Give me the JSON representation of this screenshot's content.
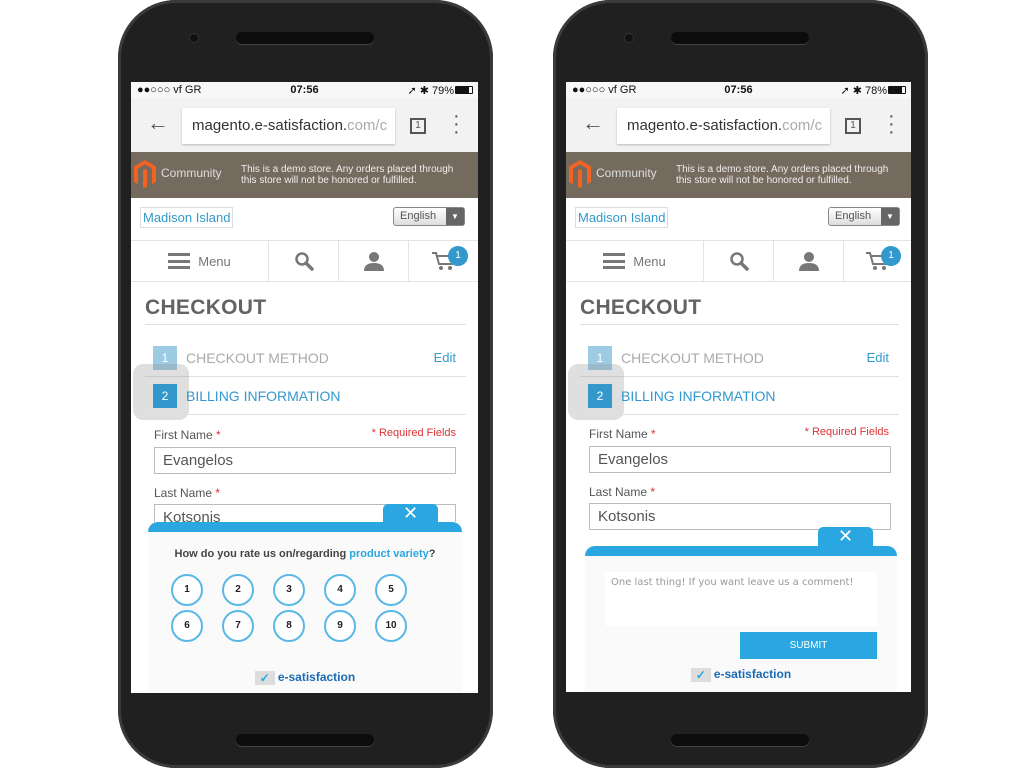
{
  "colors": {
    "accent": "#2aa7e0",
    "brand_blue": "#3399cc",
    "banner": "#756a5e"
  },
  "phones": [
    {
      "status": {
        "carrier": "●●○○○ vf GR",
        "time": "07:56",
        "right": "➚ ✱ 79%"
      },
      "browser": {
        "url_main": "magento.e-satisfaction.",
        "url_faded": "com/c",
        "tab_count": "1"
      },
      "banner": {
        "brand": "Community",
        "notice": "This is a demo store. Any orders placed through this store will not be honored or fulfilled."
      },
      "store": {
        "logo": "Madison Island",
        "language": "English"
      },
      "nav": {
        "menu": "Menu",
        "cart_count": "1"
      },
      "checkout": {
        "title": "CHECKOUT",
        "step1_num": "1",
        "step1": "CHECKOUT METHOD",
        "edit": "Edit",
        "step2_num": "2",
        "step2": "BILLING INFORMATION",
        "first_label": "First Name",
        "last_label": "Last Name",
        "required_mark": "*",
        "required": "* Required Fields",
        "first_value": "Evangelos",
        "last_value": "Kotsonis"
      }
    },
    {
      "status": {
        "carrier": "●●○○○ vf GR",
        "time": "07:56",
        "right": "➚ ✱ 78%"
      },
      "browser": {
        "url_main": "magento.e-satisfaction.",
        "url_faded": "com/c",
        "tab_count": "1"
      },
      "banner": {
        "brand": "Community",
        "notice": "This is a demo store. Any orders placed through this store will not be honored or fulfilled."
      },
      "store": {
        "logo": "Madison Island",
        "language": "English"
      },
      "nav": {
        "menu": "Menu",
        "cart_count": "1"
      },
      "checkout": {
        "title": "CHECKOUT",
        "step1_num": "1",
        "step1": "CHECKOUT METHOD",
        "edit": "Edit",
        "step2_num": "2",
        "step2": "BILLING INFORMATION",
        "first_label": "First Name",
        "last_label": "Last Name",
        "required_mark": "*",
        "required": "* Required Fields",
        "first_value": "Evangelos",
        "last_value": "Kotsonis"
      }
    }
  ],
  "rating_popup": {
    "close": "✕",
    "question_prefix": "How do you rate us on/regarding ",
    "question_topic": "product variety",
    "question_suffix": "?",
    "options": [
      "1",
      "2",
      "3",
      "4",
      "5",
      "6",
      "7",
      "8",
      "9",
      "10"
    ],
    "brand": "e-satisfaction"
  },
  "comment_popup": {
    "close": "✕",
    "placeholder": "One last thing! If you want leave us a comment!",
    "submit": "SUBMIT",
    "brand": "e-satisfaction"
  }
}
